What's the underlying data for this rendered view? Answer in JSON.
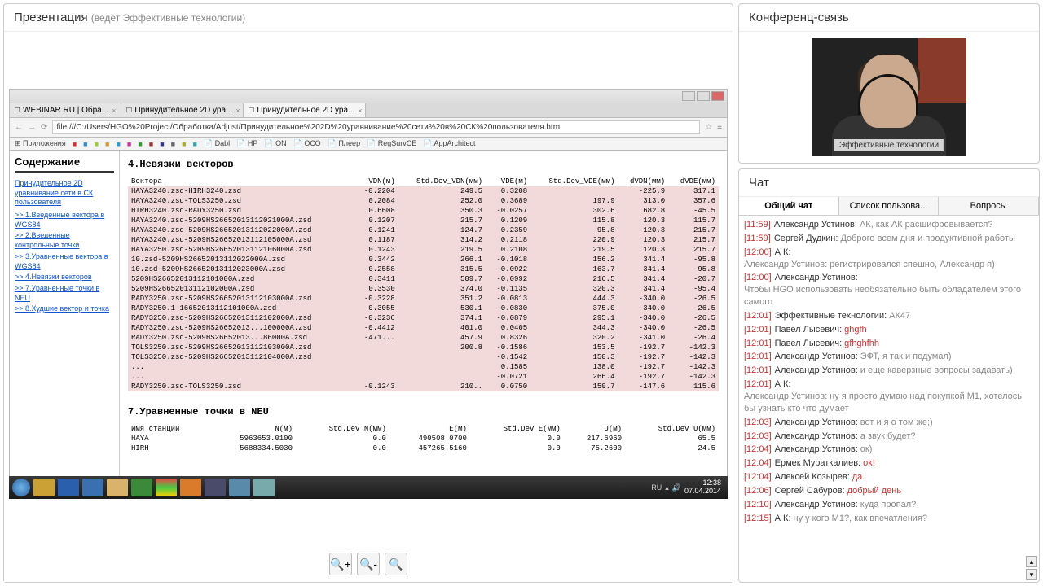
{
  "presentation": {
    "title": "Презентация",
    "subtitle": "(ведет Эффективные технологии)"
  },
  "browser": {
    "tabs": [
      {
        "label": "WEBINAR.RU | Обра...",
        "active": false
      },
      {
        "label": "Принудительное 2D ура...",
        "active": false
      },
      {
        "label": "Принудительное 2D ура...",
        "active": true
      }
    ],
    "url": "file:///C:/Users/HGO%20Project/Обработка/Adjust/Принудительное%202D%20уравнивание%20сети%20в%20СК%20пользователя.htm",
    "bookmarks": [
      "Приложения",
      "Dabl",
      "HP",
      "ON",
      "ОСО",
      "Плеер",
      "RegSurvCE",
      "AppArchitect"
    ]
  },
  "toc": {
    "title": "Содержание",
    "main_link": "Принудительное 2D уравнивание сети в СК пользователя",
    "links": [
      "1.Введенные векторa в WGS84",
      "2.Введенные контрольные точки",
      "3.Уравненные векторa в WGS84",
      "4.Невязки векторов",
      "7.Уравненные точки в NEU",
      "8.Худшие вектор и точка"
    ]
  },
  "sections": {
    "s4_title": "4.Невязки векторов",
    "s7_title": "7.Уравненные точки в NEU"
  },
  "table4": {
    "headers": [
      "Вектора",
      "VDN(м)",
      "Std.Dev_VDN(мм)",
      "VDE(м)",
      "Std.Dev_VDE(мм)",
      "dVDN(мм)",
      "dVDE(мм)"
    ],
    "rows": [
      [
        "HAYA3240.zsd-HIRH3240.zsd",
        "-0.2204",
        "249.5",
        "0.3208",
        "",
        "-225.9",
        "317.1"
      ],
      [
        "HAYA3240.zsd-TOLS3250.zsd",
        "0.2084",
        "252.0",
        "0.3689",
        "197.9",
        "313.0",
        "357.6"
      ],
      [
        "HIRH3240.zsd-RADY3250.zsd",
        "0.6608",
        "350.3",
        "-0.0257",
        "302.6",
        "682.8",
        "-45.5"
      ],
      [
        "HAYA3240.zsd-5209HS26652013112021000A.zsd",
        "0.1207",
        "215.7",
        "0.1209",
        "115.8",
        "120.3",
        "115.7"
      ],
      [
        "HAYA3240.zsd-5209HS26652013112022000A.zsd",
        "0.1241",
        "124.7",
        "0.2359",
        "95.8",
        "120.3",
        "215.7"
      ],
      [
        "HAYA3240.zsd-5209HS26652013112105000A.zsd",
        "0.1187",
        "314.2",
        "0.2118",
        "220.9",
        "120.3",
        "215.7"
      ],
      [
        "HAYA3250.zsd-5209HS26652013112106000A.zsd",
        "0.1243",
        "219.5",
        "0.2108",
        "219.5",
        "120.3",
        "215.7"
      ],
      [
        "10.zsd-5209HS26652013112022000A.zsd",
        "0.3442",
        "266.1",
        "-0.1018",
        "156.2",
        "341.4",
        "-95.8"
      ],
      [
        "10.zsd-5209HS26652013112023000A.zsd",
        "0.2558",
        "315.5",
        "-0.0922",
        "163.7",
        "341.4",
        "-95.8"
      ],
      [
        "5209HS26652013112101000A.zsd",
        "0.3411",
        "509.7",
        "-0.0992",
        "216.5",
        "341.4",
        "-20.7"
      ],
      [
        "5209HS26652013112102000A.zsd",
        "0.3530",
        "374.0",
        "-0.1135",
        "320.3",
        "341.4",
        "-95.4"
      ],
      [
        "RADY3250.zsd-5209HS26652013112103000A.zsd",
        "-0.3228",
        "351.2",
        "-0.0813",
        "444.3",
        "-340.0",
        "-26.5"
      ],
      [
        "RADY3250.1   16652013112101000A.zsd",
        "-0.3055",
        "530.1",
        "-0.0830",
        "375.0",
        "-340.0",
        "-26.5"
      ],
      [
        "RADY3250.zsd-5209HS26652013112102000A.zsd",
        "-0.3236",
        "374.1",
        "-0.0879",
        "295.1",
        "-340.0",
        "-26.5"
      ],
      [
        "RADY3250.zsd-5209HS26652013...100000A.zsd",
        "-0.4412",
        "401.0",
        "0.0405",
        "344.3",
        "-340.0",
        "-26.5"
      ],
      [
        "RADY3250.zsd-5209HS26652013...86000A.zsd",
        "-471...",
        "457.9",
        "0.8326",
        "320.2",
        "-341.0",
        "-26.4"
      ],
      [
        "TOLS3250.zsd-5209HS26652013112103000A.zsd",
        "",
        "200.8",
        "-0.1586",
        "153.5",
        "-192.7",
        "-142.3"
      ],
      [
        "TOLS3250.zsd-5209HS26652013112104000A.zsd",
        "",
        "",
        "-0.1542",
        "150.3",
        "-192.7",
        "-142.3"
      ],
      [
        "...",
        "",
        "",
        "0.1585",
        "138.0",
        "-192.7",
        "-142.3"
      ],
      [
        "...",
        "",
        "",
        "-0.0721",
        "266.4",
        "-192.7",
        "-142.3"
      ],
      [
        "RADY3250.zsd-TOLS3250.zsd",
        "-0.1243",
        "210..",
        "0.0750",
        "150.7",
        "-147.6",
        "115.6"
      ]
    ]
  },
  "table7": {
    "headers": [
      "Имя станции",
      "N(м)",
      "Std.Dev_N(мм)",
      "E(м)",
      "Std.Dev_E(мм)",
      "U(м)",
      "Std.Dev_U(мм)"
    ],
    "rows": [
      [
        "HAYA",
        "5963653.0100",
        "0.0",
        "490508.0700",
        "0.0",
        "217.6960",
        "65.5"
      ],
      [
        "HIRH",
        "5688334.5030",
        "0.0",
        "457265.5160",
        "0.0",
        "75.2600",
        "24.5"
      ]
    ]
  },
  "taskbar": {
    "lang": "RU",
    "time": "12:38",
    "date": "07.04.2014"
  },
  "conference": {
    "title": "Конференц-связь",
    "caption": "Эффективные технологии"
  },
  "chat": {
    "title": "Чат",
    "tabs": [
      "Общий чат",
      "Список пользова...",
      "Вопросы"
    ],
    "messages": [
      {
        "t": "[11:59]",
        "a": "Александр Устинов:",
        "m": "АК, как АК расшифровывается?",
        "red": false
      },
      {
        "t": "[11:59]",
        "a": "Сергей Дудкин:",
        "m": "Доброго всем дня и продуктивной работы",
        "red": false
      },
      {
        "t": "[12:00]",
        "a": "А К:",
        "m": "Александр Устинов: регистрировался спешно, Александр я)",
        "red": false
      },
      {
        "t": "[12:00]",
        "a": "Александр Устинов:",
        "m": "Чтобы HGO использовать необязательно быть обладателем этого самого",
        "red": false
      },
      {
        "t": "[12:01]",
        "a": "Эффективные технологии:",
        "m": "АК47",
        "red": false
      },
      {
        "t": "[12:01]",
        "a": "Павел Лысевич:",
        "m": "ghgfh",
        "red": true
      },
      {
        "t": "[12:01]",
        "a": "Павел Лысевич:",
        "m": "gfhghfhh",
        "red": true
      },
      {
        "t": "[12:01]",
        "a": "Александр Устинов:",
        "m": "ЭФТ, я так и подумал)",
        "red": false
      },
      {
        "t": "[12:01]",
        "a": "Александр Устинов:",
        "m": "и еще каверзные вопросы задавать)",
        "red": false
      },
      {
        "t": "[12:01]",
        "a": "А К:",
        "m": "Александр Устинов: ну я просто думаю над покупкой М1, хотелось бы узнать кто что думает",
        "red": false
      },
      {
        "t": "[12:03]",
        "a": "Александр Устинов:",
        "m": "вот и я о том же;)",
        "red": false
      },
      {
        "t": "[12:03]",
        "a": "Александр Устинов:",
        "m": "а звук будет?",
        "red": false
      },
      {
        "t": "[12:04]",
        "a": "Александр Устинов:",
        "m": "ок)",
        "red": false
      },
      {
        "t": "[12:04]",
        "a": "Ермек Мураткалиев:",
        "m": "ok!",
        "red": true
      },
      {
        "t": "[12:04]",
        "a": "Алексей Козырев:",
        "m": "да",
        "red": true
      },
      {
        "t": "[12:06]",
        "a": "Сергей Сабуров:",
        "m": "добрый день",
        "red": true
      },
      {
        "t": "[12:10]",
        "a": "Александр Устинов:",
        "m": "куда пропал?",
        "red": false
      },
      {
        "t": "[12:15]",
        "a": "А К:",
        "m": "ну у кого М1?, как впечатления?",
        "red": false
      }
    ]
  },
  "zoom": {
    "in": "⊕",
    "reset": "⊖",
    "fit": "⊙"
  }
}
